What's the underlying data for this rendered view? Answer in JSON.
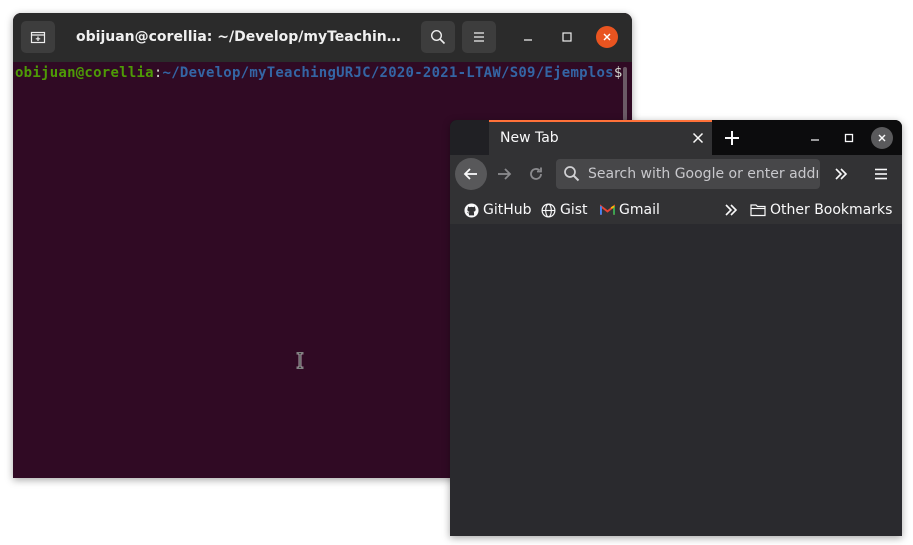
{
  "terminal": {
    "title": "obijuan@corellia: ~/Develop/myTeachingUR...",
    "prompt_user": "obijuan@corellia",
    "prompt_sep": ":",
    "prompt_path": "~/Develop/myTeachingURJC/2020-2021-LTAW/S09/Ejemplos",
    "prompt_symbol": "$",
    "colors": {
      "background": "#300a24",
      "user": "#4e9a06",
      "path": "#3465a4",
      "close": "#e95420"
    }
  },
  "browser": {
    "tab_title": "New Tab",
    "search_placeholder": "Search with Google or enter address",
    "bookmarks": [
      {
        "label": "GitHub",
        "icon": "github-icon"
      },
      {
        "label": "Gist",
        "icon": "globe-icon"
      },
      {
        "label": "Gmail",
        "icon": "gmail-icon"
      }
    ],
    "other_bookmarks": "Other Bookmarks",
    "colors": {
      "accent": "#ff7139",
      "content": "#2a2a2e"
    }
  }
}
